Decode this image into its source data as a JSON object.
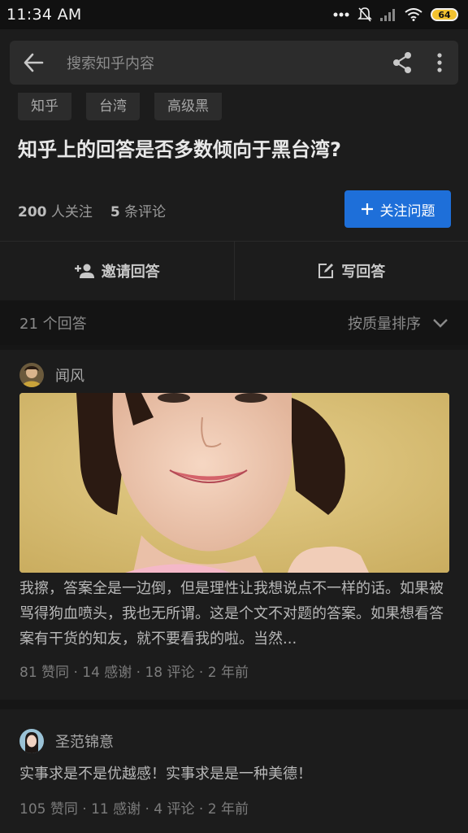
{
  "status_bar": {
    "time": "11:34 AM",
    "battery": "64",
    "icons": [
      "dots-icon",
      "mute-icon",
      "signal-icon",
      "wifi-icon",
      "battery-icon"
    ]
  },
  "search": {
    "placeholder": "搜索知乎内容"
  },
  "question": {
    "tags": [
      "知乎",
      "台湾",
      "高级黑"
    ],
    "title": "知乎上的回答是否多数倾向于黑台湾?",
    "followers_count": "200",
    "followers_label": "人关注",
    "comments_count": "5",
    "comments_label": "条评论",
    "follow_button": "关注问题"
  },
  "actions": {
    "invite": "邀请回答",
    "write": "写回答"
  },
  "answers_header": {
    "count_label": "21 个回答",
    "sort_label": "按质量排序"
  },
  "answers": [
    {
      "author": "闻风",
      "excerpt": "我擦，答案全是一边倒，但是理性让我想说点不一样的话。如果被骂得狗血喷头，我也无所谓。这是个文不对题的答案。如果想看答案有干货的知友，就不要看我的啦。当然...",
      "meta": "81 赞同 · 14 感谢 · 18 评论 · 2 年前"
    },
    {
      "author": "圣范锦意",
      "excerpt": "实事求是不是优越感！实事求是是一种美德！",
      "meta": "105 赞同 · 11 感谢 · 4 评论 · 2 年前"
    }
  ],
  "colors": {
    "accent": "#1e6fd9",
    "background": "#161616",
    "card": "#1c1c1c"
  }
}
